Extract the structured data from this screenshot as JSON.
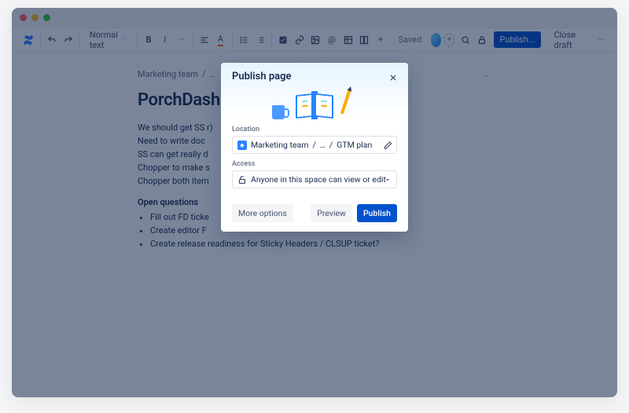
{
  "toolbar": {
    "text_style": "Normal text",
    "saved_label": "Saved",
    "publish_label": "Publish...",
    "close_draft_label": "Close draft"
  },
  "breadcrumb": {
    "space": "Marketing team",
    "sep": "/",
    "current": "…"
  },
  "doc": {
    "title": "PorchDashi",
    "p1": "We should get SS                                                         r)",
    "p2": "Need to write doc",
    "p3": "SS can get really d",
    "p4": "Chopper to make s",
    "p5": "Chopper both item",
    "oq_heading": "Open questions",
    "li1": "Fill out FD ticke",
    "li2": "Create editor F",
    "li3": "Create release readiness for Sticky Headers / CLSUP ticket?"
  },
  "modal": {
    "title": "Publish page",
    "location_label": "Location",
    "access_label": "Access",
    "breadcrumb": {
      "space": "Marketing team",
      "mid": "…",
      "leaf": "GTM plan",
      "sep": "/"
    },
    "access_value": "Anyone in this space can view or edit",
    "more_options": "More options",
    "preview": "Preview",
    "publish": "Publish"
  }
}
